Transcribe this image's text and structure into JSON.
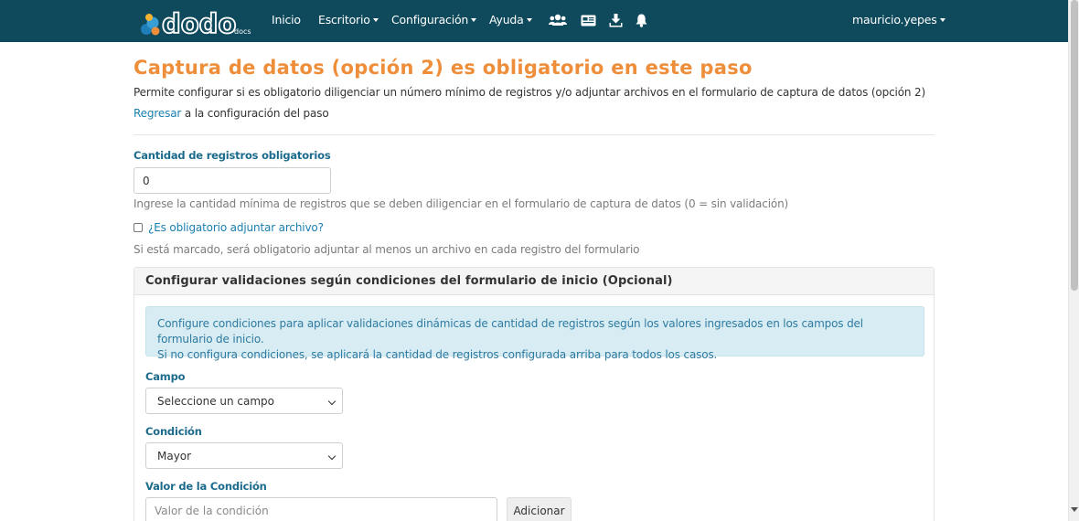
{
  "brand": {
    "name": "dodo",
    "suffix": "docs"
  },
  "nav": {
    "items": [
      {
        "label": "Inicio"
      },
      {
        "label": "Escritorio"
      },
      {
        "label": "Configuración"
      },
      {
        "label": "Ayuda"
      }
    ],
    "user": "mauricio.yepes"
  },
  "page": {
    "title": "Captura de datos (opción 2) es obligatorio en este paso",
    "description": "Permite configurar si es obligatorio diligenciar un número mínimo de registros y/o adjuntar archivos en el formulario de captura de datos (opción 2)",
    "back_link": "Regresar",
    "back_suffix": " a la configuración del paso"
  },
  "form": {
    "count_label": "Cantidad de registros obligatorios",
    "count_value": "0",
    "count_help": "Ingrese la cantidad mínima de registros que se deben diligenciar en el formulario de captura de datos (0 = sin validación)",
    "attach_label": "¿Es obligatorio adjuntar archivo?",
    "attach_checked": false,
    "attach_help": "Si está marcado, será obligatorio adjuntar al menos un archivo en cada registro del formulario"
  },
  "panel": {
    "title": "Configurar validaciones según condiciones del formulario de inicio (Opcional)",
    "alert_line1": "Configure condiciones para aplicar validaciones dinámicas de cantidad de registros según los valores ingresados en los campos del formulario de inicio.",
    "alert_line2": "Si no configura condiciones, se aplicará la cantidad de registros configurada arriba para todos los casos.",
    "field_label": "Campo",
    "field_selected": "Seleccione un campo",
    "condition_label": "Condición",
    "condition_selected": "Mayor",
    "value_label": "Valor de la Condición",
    "value_placeholder": "Valor de la condición",
    "add_button": "Adicionar"
  },
  "colors": {
    "navbar": "#0e4a5c",
    "title_orange": "#ee8e3b",
    "label_teal": "#1c6b8c",
    "link_blue": "#1a7fb0",
    "alert_bg": "#d8ecf3"
  }
}
